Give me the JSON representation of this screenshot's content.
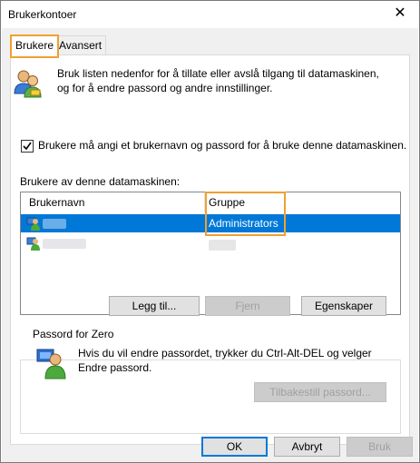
{
  "window": {
    "title": "Brukerkontoer",
    "close_glyph": "✕"
  },
  "tabs": [
    {
      "label": "Brukere"
    },
    {
      "label": "Avansert"
    }
  ],
  "intro_text_1": "Bruk listen nedenfor for å tillate eller avslå tilgang til datamaskinen,",
  "intro_text_2": "og for å endre passord og andre innstillinger.",
  "require_login": {
    "label": "Brukere må angi et brukernavn og passord for å bruke denne datamaskinen.",
    "checked": true
  },
  "users_list": {
    "label": "Brukere av denne datamaskinen:",
    "columns": [
      "Brukernavn",
      "Gruppe"
    ],
    "rows": [
      {
        "name": "",
        "group": "Administrators",
        "selected": true
      },
      {
        "name": "",
        "group": "",
        "selected": false
      }
    ]
  },
  "list_buttons": {
    "add": "Legg til...",
    "remove": "Fjern",
    "properties": "Egenskaper"
  },
  "password_group": {
    "title": "Passord for Zero",
    "text_1": "Hvis du vil endre passordet, trykker du Ctrl-Alt-DEL og velger",
    "text_2": "Endre passord.",
    "reset_button": "Tilbakestill passord..."
  },
  "footer": {
    "ok": "OK",
    "cancel": "Avbryt",
    "apply": "Bruk"
  },
  "colors": {
    "selection": "#0078d7",
    "highlight": "#f0a030"
  },
  "icons": [
    "users-icon",
    "user-icon",
    "password-user-icon",
    "checkmark-icon",
    "close-icon"
  ]
}
